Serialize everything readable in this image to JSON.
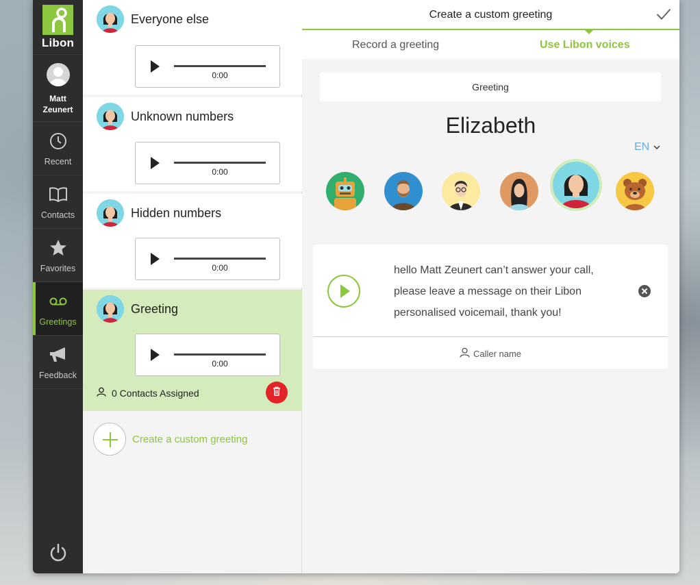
{
  "sidebar": {
    "logo_text": "Libon",
    "user": {
      "first": "Matt",
      "last": "Zeunert"
    },
    "items": [
      {
        "label": "Recent",
        "icon": "clock-icon"
      },
      {
        "label": "Contacts",
        "icon": "book-icon"
      },
      {
        "label": "Favorites",
        "icon": "star-icon"
      },
      {
        "label": "Greetings",
        "icon": "voicemail-icon",
        "active": true
      },
      {
        "label": "Feedback",
        "icon": "megaphone-icon"
      }
    ]
  },
  "greetings": [
    {
      "title": "Everyone else",
      "time": "0:00"
    },
    {
      "title": "Unknown numbers",
      "time": "0:00"
    },
    {
      "title": "Hidden numbers",
      "time": "0:00"
    },
    {
      "title": "Greeting",
      "time": "0:00",
      "selected": true,
      "assigned": "0 Contacts Assigned"
    }
  ],
  "create_label": "Create a custom greeting",
  "panel": {
    "title": "Create a custom greeting",
    "tabs": {
      "record": "Record a greeting",
      "voices": "Use Libon voices"
    },
    "greeting_label": "Greeting",
    "voice_name": "Elizabeth",
    "language": "EN",
    "message": "hello Matt Zeunert can’t answer your call, please leave a message on their Libon personalised voicemail, thank you!",
    "caller_name": "Caller name"
  },
  "colors": {
    "accent": "#8dc63f",
    "sidebar": "#2d2d2d",
    "danger": "#e32328",
    "link_blue": "#6aaee0"
  }
}
